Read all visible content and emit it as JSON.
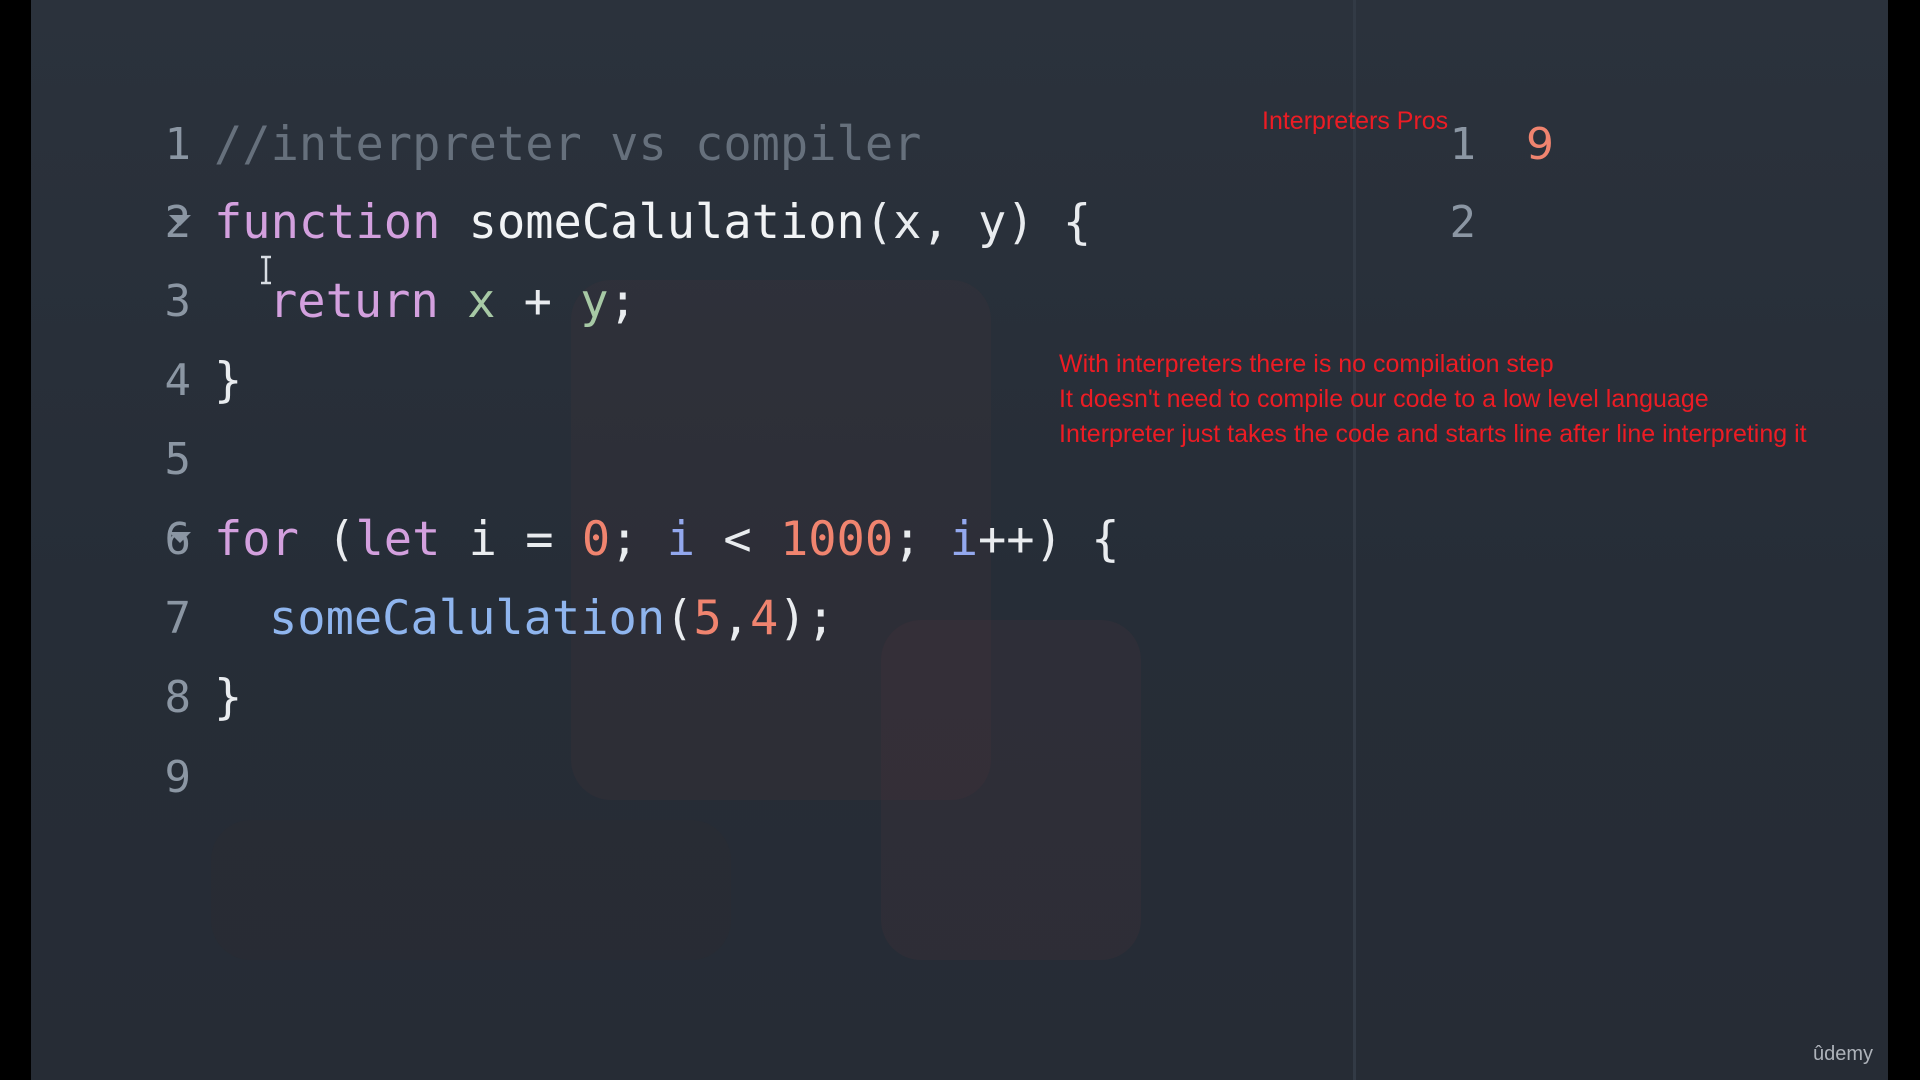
{
  "editor": {
    "lines": [
      {
        "number": "1"
      },
      {
        "number": "2"
      },
      {
        "number": "3"
      },
      {
        "number": "4"
      },
      {
        "number": "5"
      },
      {
        "number": "6"
      },
      {
        "number": "7"
      },
      {
        "number": "8"
      },
      {
        "number": "9"
      }
    ],
    "code": {
      "line1_comment": "//interpreter vs compiler",
      "line2_kw": "function",
      "line2_fn": "someCalulation",
      "line2_open": "(",
      "line2_x": "x",
      "line2_comma": ", ",
      "line2_y": "y",
      "line2_close": ") {",
      "line3_kw": "return",
      "line3_x": "x",
      "line3_plus": " + ",
      "line3_y": "y",
      "line3_semi": ";",
      "line4": "}",
      "line6_kw": "for",
      "line6_open": " (",
      "line6_let": "let",
      "line6_i1": " i",
      "line6_eq": " = ",
      "line6_zero": "0",
      "line6_semi1": "; ",
      "line6_i2": "i",
      "line6_lt": " < ",
      "line6_thousand": "1000",
      "line6_semi2": "; ",
      "line6_i3": "i",
      "line6_inc": "++) {",
      "line7_fn": "someCalulation",
      "line7_open": "(",
      "line7_five": "5",
      "line7_comma": ",",
      "line7_four": "4",
      "line7_close": ");",
      "line8": "}"
    }
  },
  "output": {
    "lines": [
      {
        "number": "1",
        "value": "9"
      },
      {
        "number": "2",
        "value": ""
      }
    ]
  },
  "annotations": {
    "title": "Interpreters Pros",
    "lines": [
      "With interpreters there is no compilation step",
      "It doesn't need to compile our code to a low level language",
      "Interpreter just takes the code and starts line after line interpreting it"
    ]
  },
  "watermark": "ûdemy",
  "colors": {
    "annotation": "#ec1c24",
    "background": "#2b323c",
    "number_literal": "#f0846f"
  }
}
